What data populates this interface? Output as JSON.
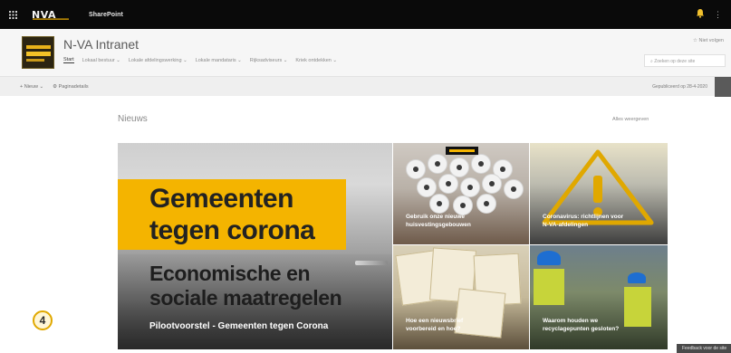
{
  "suite": {
    "brand": "N-VA",
    "app_name": "SharePoint",
    "icons": {
      "waffle": "waffle-icon",
      "notifications": "bell-icon",
      "more": "more-icon"
    }
  },
  "site": {
    "title": "N-VA Intranet",
    "follow_label": "☆ Niet volgen",
    "search_placeholder": "Zoeken op deze site",
    "nav": [
      {
        "label": "Start",
        "active": true
      },
      {
        "label": "Lokaal bestuur ⌄",
        "active": false
      },
      {
        "label": "Lokale afdelingswerking ⌄",
        "active": false
      },
      {
        "label": "Lokale mandataris ⌄",
        "active": false
      },
      {
        "label": "Rijksadviseurs ⌄",
        "active": false
      },
      {
        "label": "Kriek ontdekken ⌄",
        "active": false
      }
    ]
  },
  "command_bar": {
    "new_label": "+ Nieuw ⌄",
    "details_label": "⚙ Paginadetails",
    "status": "Gepubliceerd op 28-4-2020"
  },
  "news": {
    "section_title": "Nieuws",
    "see_all": "Alles weergeven",
    "hero": {
      "line1": "Gemeenten",
      "line2": "tegen corona",
      "line3": "Economische en",
      "line4": "sociale maatregelen",
      "caption": "Pilootvoorstel - Gemeenten tegen Corona"
    },
    "tiles": [
      {
        "caption_1": "Gebruik onze nieuwe",
        "caption_2": "huisvestingsgebouwen"
      },
      {
        "caption_1": "Coronavirus: richtlijnen voor",
        "caption_2": "N-VA-afdelingen"
      },
      {
        "caption_1": "Hoe een nieuwsbrief",
        "caption_2": "voorbereid en hoe?"
      },
      {
        "caption_1": "Waarom houden we",
        "caption_2": "recyclagepunten gesloten?"
      }
    ]
  },
  "badge": "4",
  "feedback": "Feedback voor de site",
  "colors": {
    "brand_yellow": "#f4b400",
    "suite_bar": "#0a0a0a"
  }
}
